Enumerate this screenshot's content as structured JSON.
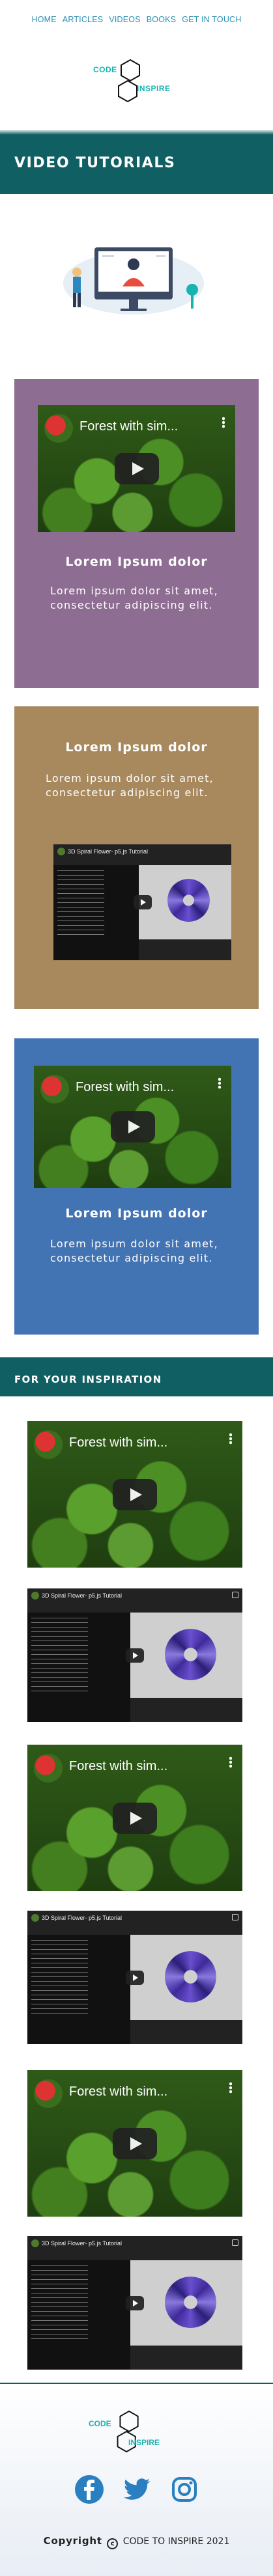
{
  "nav": {
    "items": [
      "HOME",
      "ARTICLES",
      "VIDEOS",
      "BOOKS",
      "GET IN TOUCH"
    ]
  },
  "logo": {
    "line1": "CODE",
    "line2": "INSPIRE"
  },
  "banner": {
    "title": "VIDEO TUTORIALS"
  },
  "cards": [
    {
      "heading": "Lorem Ipsum dolor",
      "text": "Lorem ipsum dolor sit amet, consectetur adipiscing elit.",
      "video_title": "Forest with sim..."
    },
    {
      "heading": "Lorem Ipsum dolor",
      "text": "Lorem ipsum dolor sit amet, consectetur adipiscing elit.",
      "video_title": "3D Spiral Flower- p5.js Tutorial"
    },
    {
      "heading": "Lorem Ipsum dolor",
      "text": "Lorem ipsum dolor sit amet, consectetur adipiscing elit.",
      "video_title": "Forest with sim..."
    }
  ],
  "inspiration": {
    "title": "FOR YOUR INSPIRATION"
  },
  "videos": [
    {
      "title": "Forest with sim..."
    },
    {
      "title": "3D Spiral Flower- p5.js Tutorial"
    },
    {
      "title": "Forest with sim..."
    },
    {
      "title": "3D Spiral Flower- p5.js Tutorial"
    },
    {
      "title": "Forest with sim..."
    },
    {
      "title": "3D Spiral Flower- p5.js Tutorial"
    }
  ],
  "footer": {
    "logo_line1": "CODE",
    "logo_line2": "INSPIRE",
    "copyright": "Copyright",
    "company": "CODE TO INSPIRE",
    "year": "2021",
    "social": [
      "facebook-icon",
      "twitter-icon",
      "instagram-icon"
    ]
  },
  "colors": {
    "teal": "#0f5f63",
    "accent": "#16b3b0",
    "nav_link": "#2a8fb6",
    "card1": "#8d6d91",
    "card2": "#a8895d",
    "card3": "#4273b2"
  }
}
